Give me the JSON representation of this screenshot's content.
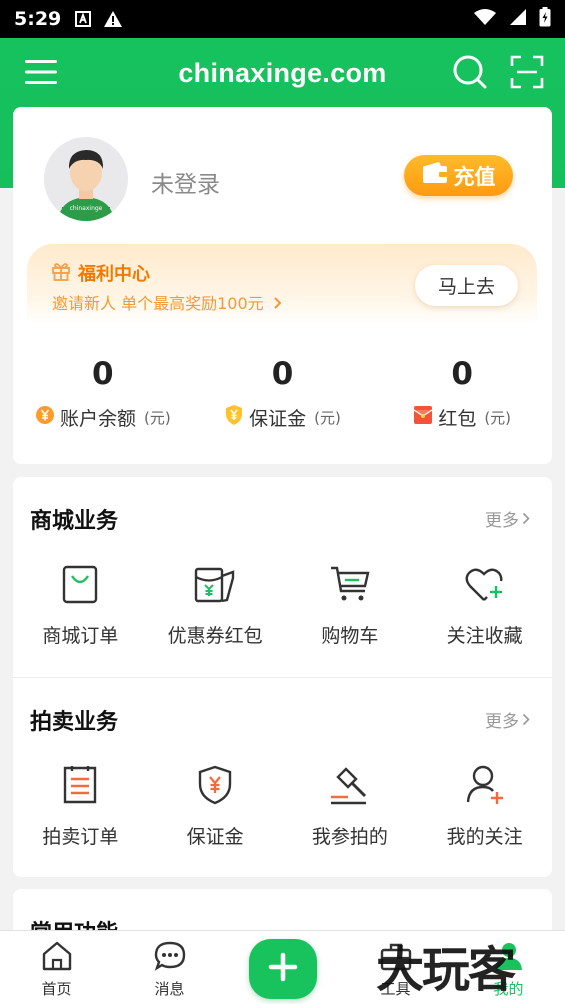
{
  "status_bar": {
    "time": "5:29",
    "icons": [
      "a-icon",
      "warning-icon",
      "wifi-icon",
      "signal-icon",
      "battery-icon"
    ]
  },
  "header": {
    "title": "chinaxinge.com",
    "icons": [
      "menu-icon",
      "search-icon",
      "scan-icon"
    ]
  },
  "profile": {
    "avatar_text": "chinaxinge",
    "login_text": "未登录",
    "recharge_label": "充值"
  },
  "welfare": {
    "title": "福利中心",
    "subtitle": "邀请新人 单个最高奖励100元",
    "go_label": "马上去"
  },
  "stats": [
    {
      "value": "0",
      "label": "账户余额",
      "unit": "(元)",
      "icon": "yuan-coin-icon"
    },
    {
      "value": "0",
      "label": "保证金",
      "unit": "(元)",
      "icon": "shield-yuan-icon"
    },
    {
      "value": "0",
      "label": "红包",
      "unit": "(元)",
      "icon": "red-envelope-icon"
    }
  ],
  "mall": {
    "title": "商城业务",
    "more": "更多",
    "items": [
      {
        "label": "商城订单",
        "icon": "shopping-bag-icon"
      },
      {
        "label": "优惠券红包",
        "icon": "coupon-icon"
      },
      {
        "label": "购物车",
        "icon": "cart-icon"
      },
      {
        "label": "关注收藏",
        "icon": "heart-plus-icon"
      }
    ]
  },
  "auction": {
    "title": "拍卖业务",
    "more": "更多",
    "items": [
      {
        "label": "拍卖订单",
        "icon": "order-list-icon"
      },
      {
        "label": "保证金",
        "icon": "deposit-shield-icon"
      },
      {
        "label": "我参拍的",
        "icon": "gavel-icon"
      },
      {
        "label": "我的关注",
        "icon": "user-plus-icon"
      }
    ]
  },
  "common": {
    "title": "常用功能"
  },
  "nav": [
    {
      "label": "首页",
      "icon": "home-icon"
    },
    {
      "label": "消息",
      "icon": "message-icon"
    },
    {
      "label": "",
      "icon": "add-icon"
    },
    {
      "label": "工具",
      "icon": "toolbox-icon"
    },
    {
      "label": "我的",
      "icon": "profile-icon"
    }
  ],
  "watermark": "大玩客",
  "colors": {
    "brand_green": "#16c25e",
    "orange": "#ff9a12",
    "accent_orange": "#f07a00"
  }
}
